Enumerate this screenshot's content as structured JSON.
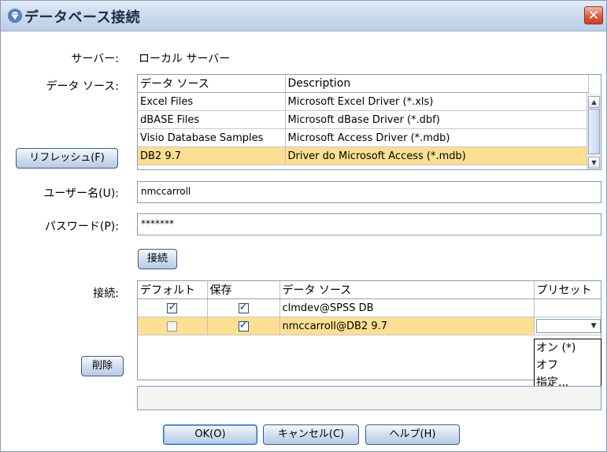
{
  "dialog": {
    "title": "データベース接続",
    "close_glyph": "✕"
  },
  "server": {
    "label": "サーバー:",
    "value": "ローカル サーバー"
  },
  "datasource": {
    "label": "データ ソース:",
    "columns": [
      "データ ソース",
      "Description"
    ],
    "rows": [
      [
        "Excel Files",
        "Microsoft Excel Driver (*.xls)"
      ],
      [
        "dBASE Files",
        "Microsoft dBase Driver (*.dbf)"
      ],
      [
        "Visio Database Samples",
        "Microsoft Access Driver (*.mdb)"
      ],
      [
        "DB2 9.7",
        "Driver do Microsoft Access (*.mdb)"
      ]
    ],
    "selected_index": 3
  },
  "refresh_button": "リフレッシュ(F)",
  "username": {
    "label": "ユーザー名(U):",
    "value": "nmccarroll"
  },
  "password": {
    "label": "パスワード(P):",
    "value": "*******"
  },
  "connect_button": "接続",
  "connections": {
    "label": "接続:",
    "columns": [
      "デフォルト",
      "保存",
      "データ ソース",
      "プリセット"
    ],
    "rows": [
      {
        "default": true,
        "save": true,
        "source": "clmdev@SPSS DB",
        "preset": ""
      },
      {
        "default": false,
        "save": true,
        "source": "nmccarroll@DB2 9.7",
        "preset": ""
      }
    ],
    "selected_index": 1
  },
  "preset_options": [
    "オン (*)",
    "オフ",
    "指定..."
  ],
  "delete_button": "削除",
  "footer": {
    "ok": "OK(O)",
    "cancel": "キャンセル(C)",
    "help": "ヘルプ(H)"
  },
  "colors": {
    "selection": "#fcdf92",
    "title_bar": "#cddbee",
    "close": "#dc5c3e"
  },
  "icons": {
    "title": "diamond-gem-icon",
    "close": "close-icon"
  }
}
